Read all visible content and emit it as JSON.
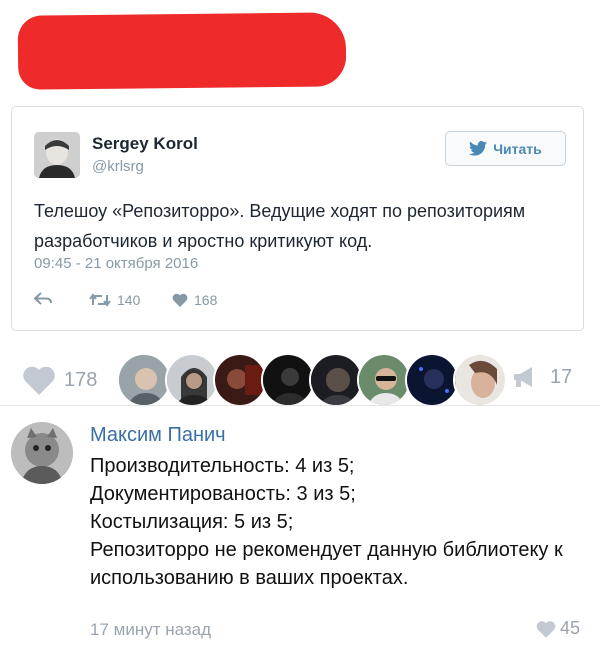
{
  "tweet": {
    "author_name": "Sergey Korol",
    "author_handle": "@krlsrg",
    "follow_label": "Читать",
    "text": "Телешоу «Репозиторро». Ведущие ходят по репозиториям разработчиков и яростно критикуют код.",
    "timestamp": "09:45 - 21 октября 2016",
    "retweets": "140",
    "likes": "168",
    "accent_color": "#4c88b6"
  },
  "post": {
    "likes": "178",
    "shares": "17"
  },
  "comment": {
    "author": "Максим Панич",
    "lines": [
      "Производительность: 4 из 5;",
      "Документированость: 3 из 5;",
      "Костылизация: 5 из 5;",
      "Репозиторро не рекомендует данную библиотеку к использованию в ваших проектах."
    ],
    "time": "17 минут назад",
    "likes": "45"
  }
}
